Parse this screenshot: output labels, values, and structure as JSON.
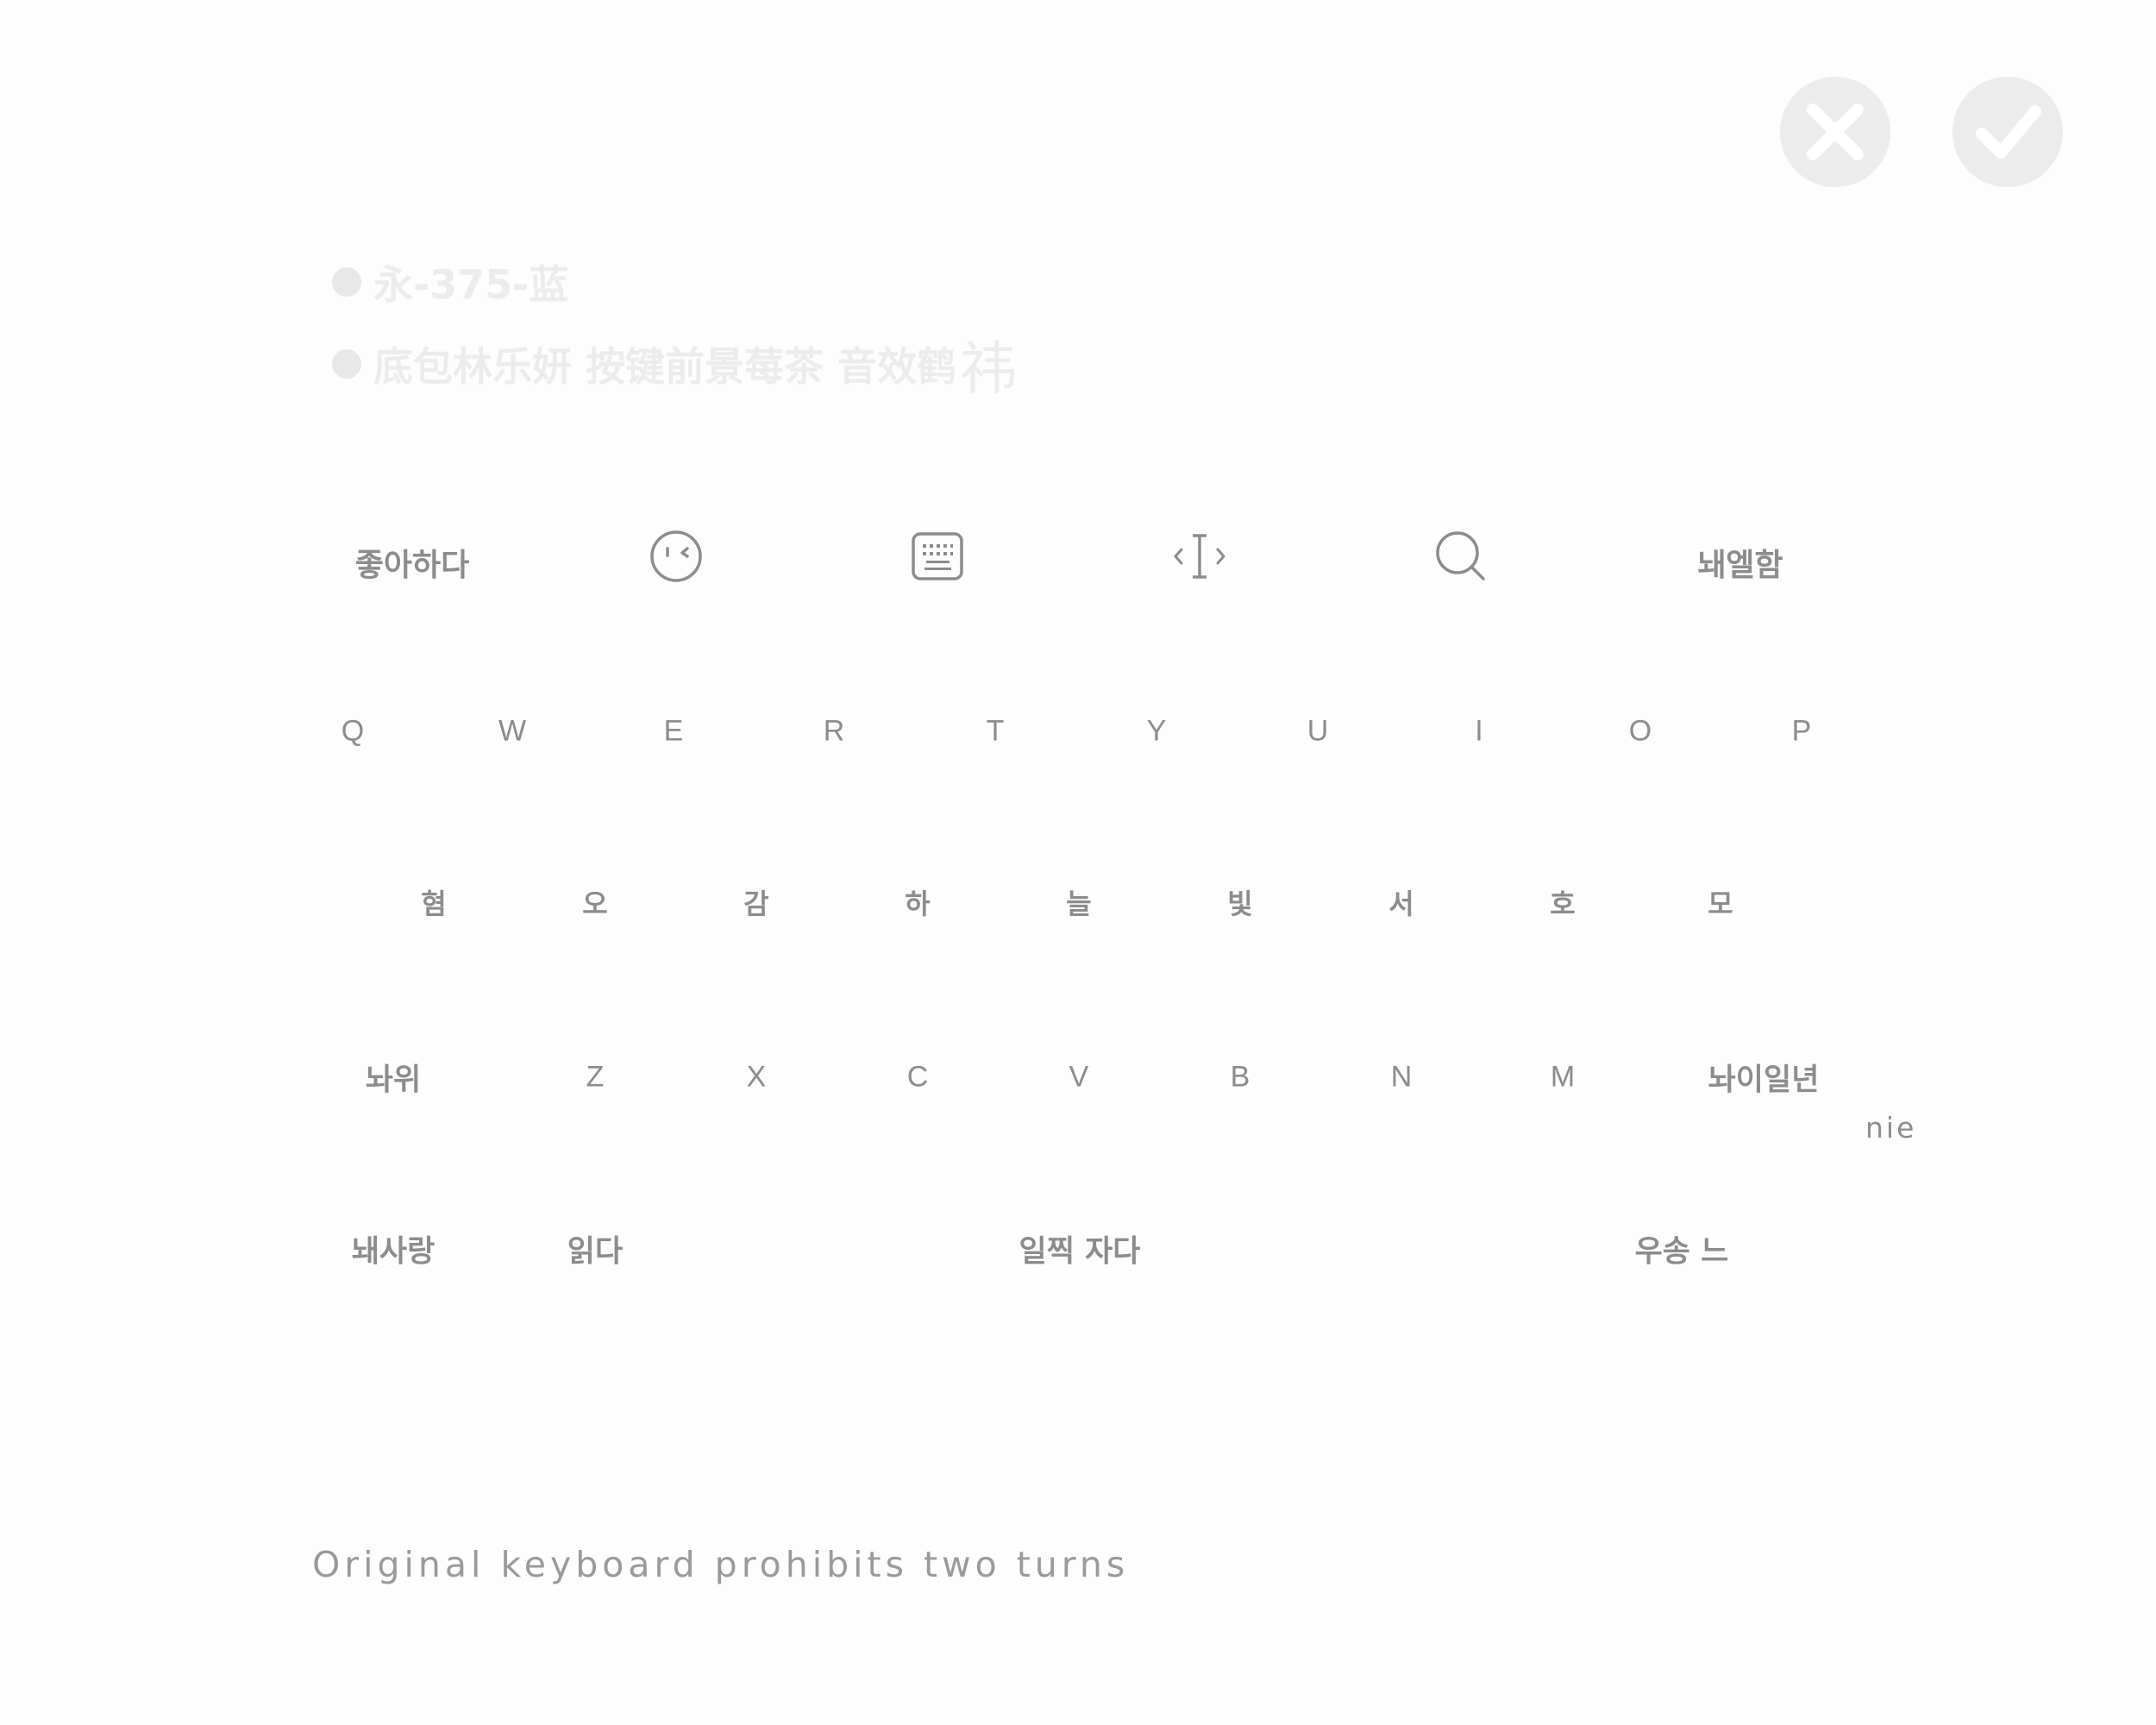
{
  "header": {
    "close_icon": "close-x-icon",
    "confirm_icon": "checkmark-icon"
  },
  "info": {
    "line1": "永-375-蓝",
    "line2": "底包林乐妍  按键前景莓茶 音效鹤",
    "line2_big": "祎"
  },
  "toolbar": {
    "left_label": "좋아하다",
    "emoji_icon": "emoji-face-icon",
    "keyboard_icon": "keyboard-icon",
    "cursor_icon": "cursor-move-icon",
    "search_icon": "search-icon",
    "right_label": "놰엘함"
  },
  "rows": {
    "row1": [
      "Q",
      "W",
      "E",
      "R",
      "T",
      "Y",
      "U",
      "I",
      "O",
      "P"
    ],
    "row2": [
      "혐",
      "오",
      "감",
      "하",
      "늘",
      "빛",
      "서",
      "호",
      "모"
    ],
    "row3": [
      "놔위",
      "Z",
      "X",
      "C",
      "V",
      "B",
      "N",
      "M",
      "놔이일년"
    ],
    "row4": {
      "left": "놰사랑",
      "second": "읽다",
      "space": "일찍 자다",
      "right": "우송 느"
    }
  },
  "hint": "nie",
  "footer": "Original keyboard prohibits two turns",
  "colors": {
    "background": "#fdfdfd",
    "key_text": "#8c8c8c",
    "circle_button": "#ececec",
    "faint_info": "#ececec"
  }
}
